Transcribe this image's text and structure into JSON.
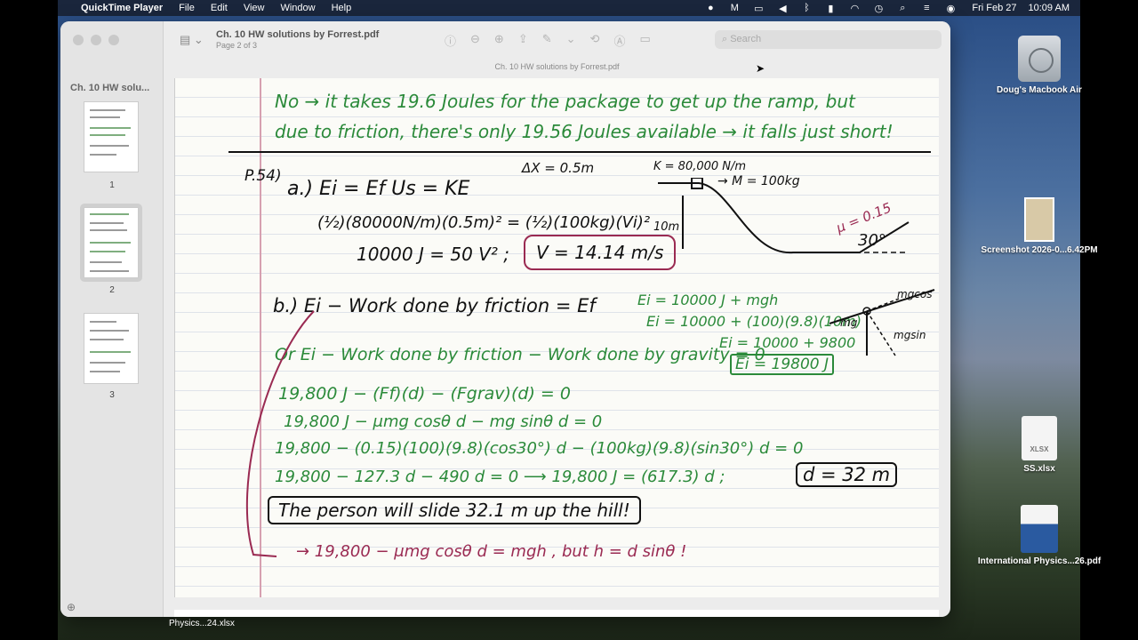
{
  "menubar": {
    "app_name": "QuickTime Player",
    "menus": [
      "File",
      "Edit",
      "View",
      "Window",
      "Help"
    ],
    "date": "Fri Feb 27",
    "time": "10:09 AM"
  },
  "window": {
    "title": "Ch. 10 HW solutions by Forrest.pdf",
    "subtitle": "Page 2 of 3",
    "filename_bar": "Ch. 10 HW solutions by Forrest.pdf",
    "search_placeholder": "Search"
  },
  "sidebar": {
    "title": "Ch. 10 HW solu...",
    "pages": [
      "1",
      "2",
      "3"
    ],
    "selected_page": "2"
  },
  "document": {
    "line1": "No → it takes 19.6 Joules for the package to get up the ramp, but",
    "line2": "due to friction, there's only 19.56 Joules available → it falls just short!",
    "p_label": "P.54)",
    "a_part": "a.) Ei = Ef    Us = KE",
    "dx": "ΔX = 0.5m",
    "k_label": "K = 80,000 N/m",
    "m_label": "→ M = 100kg",
    "eq_a": "(½)(80000N/m)(0.5m)² = (½)(100kg)(Vi)²",
    "eq_a2": "10000 J = 50 V²  ;",
    "v_result": "V = 14.14 m/s",
    "h_label": "10m",
    "mu": "μ = 0.15",
    "angle": "30°",
    "b_part": "b.) Ei − Work done by friction = Ef",
    "ei1": "Ei = 10000 J + mgh",
    "ei2": "Ei = 10000 + (100)(9.8)(10m)",
    "ei3": "Ei = 10000 + 9800",
    "ei4": "Ei = 19800 J",
    "mg": "mg",
    "mgcos": "mgcos",
    "mgsin": "mgsin",
    "or_line": "Or  Ei − Work done by friction − Work done by gravity = 0",
    "s1": "19,800 J  − (Ff)(d)  − (Fgrav)(d) = 0",
    "s2": "19,800 J − μmg cosθ d − mg sinθ d = 0",
    "s3": "19,800 − (0.15)(100)(9.8)(cos30°) d − (100kg)(9.8)(sin30°) d = 0",
    "s4": "19,800 − 127.3 d  −  490 d = 0  ⟶  19,800 J = (617.3) d ;",
    "d_result": "d = 32 m",
    "conclusion": "The person will slide 32.1 m up the hill!",
    "bottom": "→ 19,800 − μmg cosθ d = mgh ,  but  h = d sinθ !"
  },
  "desktop": {
    "drive": "Doug's Macbook Air",
    "screenshot": "Screenshot 2026-0...6.42PM",
    "xlsx": "SS.xlsx",
    "xlsx_icon_label": "XLSX",
    "pdf": "International Physics...26.pdf",
    "taskbar_file": "Physics...24.xlsx"
  }
}
